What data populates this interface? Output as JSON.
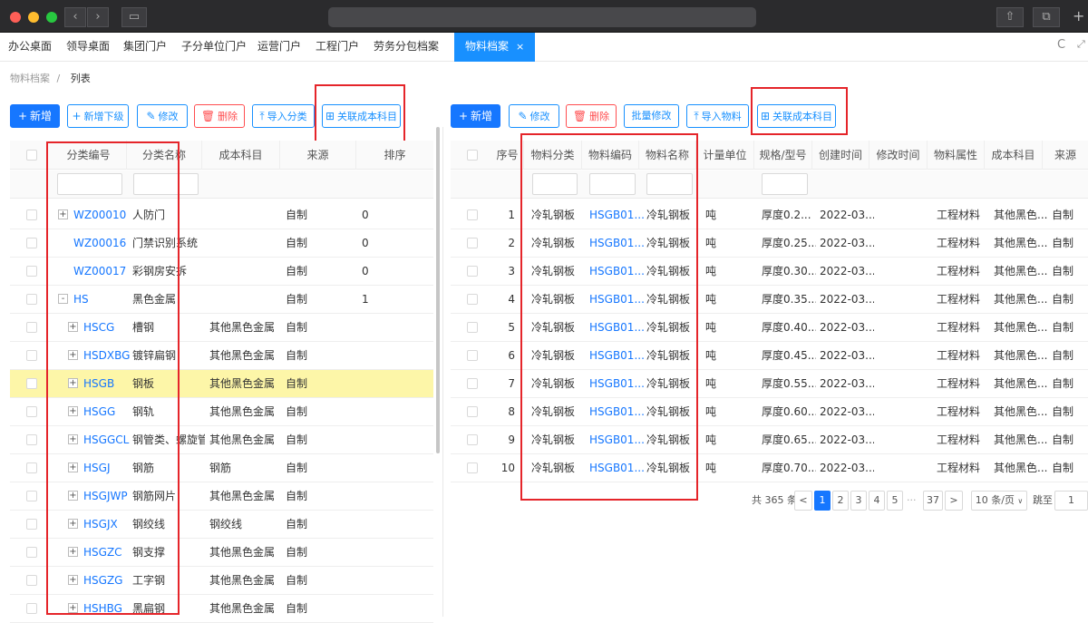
{
  "tabs": [
    {
      "label": "办公桌面"
    },
    {
      "label": "领导桌面"
    },
    {
      "label": "集团门户"
    },
    {
      "label": "子分单位门户"
    },
    {
      "label": "运营门户"
    },
    {
      "label": "工程门户"
    },
    {
      "label": "劳务分包档案"
    },
    {
      "label": "物料档案",
      "close": "×"
    }
  ],
  "breadcrumb": {
    "parent": "物料档案",
    "sep": "/",
    "current": "列表"
  },
  "left_toolbar": {
    "add": "新增",
    "add_sub": "新增下级",
    "edit": "修改",
    "delete": "删除",
    "import": "导入分类",
    "link_cost": "关联成本科目"
  },
  "right_toolbar": {
    "add": "新增",
    "edit": "修改",
    "delete": "删除",
    "batch_edit": "批量修改",
    "import": "导入物料",
    "link_cost": "关联成本科目"
  },
  "left_table": {
    "headers": [
      "分类编号",
      "分类名称",
      "成本科目",
      "来源",
      "排序"
    ],
    "rows": [
      {
        "exp": "+",
        "code": "WZ00010",
        "name": "人防门",
        "cost": "",
        "source": "自制",
        "sort": "0",
        "level": 0
      },
      {
        "exp": "",
        "code": "WZ00016",
        "name": "门禁识别系统",
        "cost": "",
        "source": "自制",
        "sort": "0",
        "level": 0
      },
      {
        "exp": "",
        "code": "WZ00017",
        "name": "彩钢房安拆",
        "cost": "",
        "source": "自制",
        "sort": "0",
        "level": 0
      },
      {
        "exp": "-",
        "code": "HS",
        "name": "黑色金属",
        "cost": "",
        "source": "自制",
        "sort": "1",
        "level": 0
      },
      {
        "exp": "+",
        "code": "HSCG",
        "name": "槽钢",
        "cost": "其他黑色金属",
        "source": "自制",
        "sort": "",
        "level": 1
      },
      {
        "exp": "+",
        "code": "HSDXBG",
        "name": "镀锌扁钢",
        "cost": "其他黑色金属",
        "source": "自制",
        "sort": "",
        "level": 1
      },
      {
        "exp": "+",
        "code": "HSGB",
        "name": "钢板",
        "cost": "其他黑色金属",
        "source": "自制",
        "sort": "",
        "level": 1,
        "highlight": true
      },
      {
        "exp": "+",
        "code": "HSGG",
        "name": "钢轨",
        "cost": "其他黑色金属",
        "source": "自制",
        "sort": "",
        "level": 1
      },
      {
        "exp": "+",
        "code": "HSGGCL",
        "name": "钢管类、螺旋管",
        "cost": "其他黑色金属",
        "source": "自制",
        "sort": "",
        "level": 1
      },
      {
        "exp": "+",
        "code": "HSGJ",
        "name": "钢筋",
        "cost": "钢筋",
        "source": "自制",
        "sort": "",
        "level": 1
      },
      {
        "exp": "+",
        "code": "HSGJWP",
        "name": "钢筋网片",
        "cost": "其他黑色金属",
        "source": "自制",
        "sort": "",
        "level": 1
      },
      {
        "exp": "+",
        "code": "HSGJX",
        "name": "钢绞线",
        "cost": "钢绞线",
        "source": "自制",
        "sort": "",
        "level": 1
      },
      {
        "exp": "+",
        "code": "HSGZC",
        "name": "钢支撑",
        "cost": "其他黑色金属",
        "source": "自制",
        "sort": "",
        "level": 1
      },
      {
        "exp": "+",
        "code": "HSGZG",
        "name": "工字钢",
        "cost": "其他黑色金属",
        "source": "自制",
        "sort": "",
        "level": 1
      },
      {
        "exp": "+",
        "code": "HSHBG",
        "name": "黑扁钢",
        "cost": "其他黑色金属",
        "source": "自制",
        "sort": "",
        "level": 1
      }
    ]
  },
  "right_table": {
    "headers": [
      "序号",
      "物料分类",
      "物料编码",
      "物料名称",
      "计量单位",
      "规格/型号",
      "创建时间",
      "修改时间",
      "物料属性",
      "成本科目",
      "来源"
    ],
    "rows": [
      {
        "no": "1",
        "cat": "冷轧钢板",
        "code": "HSGB01...",
        "name": "冷轧钢板",
        "unit": "吨",
        "spec": "厚度0.2...",
        "created": "2022-03...",
        "modified": "",
        "attr": "工程材料",
        "cost": "其他黑色...",
        "source": "自制"
      },
      {
        "no": "2",
        "cat": "冷轧钢板",
        "code": "HSGB01...",
        "name": "冷轧钢板",
        "unit": "吨",
        "spec": "厚度0.25...",
        "created": "2022-03...",
        "modified": "",
        "attr": "工程材料",
        "cost": "其他黑色...",
        "source": "自制"
      },
      {
        "no": "3",
        "cat": "冷轧钢板",
        "code": "HSGB01...",
        "name": "冷轧钢板",
        "unit": "吨",
        "spec": "厚度0.30...",
        "created": "2022-03...",
        "modified": "",
        "attr": "工程材料",
        "cost": "其他黑色...",
        "source": "自制"
      },
      {
        "no": "4",
        "cat": "冷轧钢板",
        "code": "HSGB01...",
        "name": "冷轧钢板",
        "unit": "吨",
        "spec": "厚度0.35...",
        "created": "2022-03...",
        "modified": "",
        "attr": "工程材料",
        "cost": "其他黑色...",
        "source": "自制"
      },
      {
        "no": "5",
        "cat": "冷轧钢板",
        "code": "HSGB01...",
        "name": "冷轧钢板",
        "unit": "吨",
        "spec": "厚度0.40...",
        "created": "2022-03...",
        "modified": "",
        "attr": "工程材料",
        "cost": "其他黑色...",
        "source": "自制"
      },
      {
        "no": "6",
        "cat": "冷轧钢板",
        "code": "HSGB01...",
        "name": "冷轧钢板",
        "unit": "吨",
        "spec": "厚度0.45...",
        "created": "2022-03...",
        "modified": "",
        "attr": "工程材料",
        "cost": "其他黑色...",
        "source": "自制"
      },
      {
        "no": "7",
        "cat": "冷轧钢板",
        "code": "HSGB01...",
        "name": "冷轧钢板",
        "unit": "吨",
        "spec": "厚度0.55...",
        "created": "2022-03...",
        "modified": "",
        "attr": "工程材料",
        "cost": "其他黑色...",
        "source": "自制"
      },
      {
        "no": "8",
        "cat": "冷轧钢板",
        "code": "HSGB01...",
        "name": "冷轧钢板",
        "unit": "吨",
        "spec": "厚度0.60...",
        "created": "2022-03...",
        "modified": "",
        "attr": "工程材料",
        "cost": "其他黑色...",
        "source": "自制"
      },
      {
        "no": "9",
        "cat": "冷轧钢板",
        "code": "HSGB01...",
        "name": "冷轧钢板",
        "unit": "吨",
        "spec": "厚度0.65...",
        "created": "2022-03...",
        "modified": "",
        "attr": "工程材料",
        "cost": "其他黑色...",
        "source": "自制"
      },
      {
        "no": "10",
        "cat": "冷轧钢板",
        "code": "HSGB01...",
        "name": "冷轧钢板",
        "unit": "吨",
        "spec": "厚度0.70...",
        "created": "2022-03...",
        "modified": "",
        "attr": "工程材料",
        "cost": "其他黑色...",
        "source": "自制"
      }
    ]
  },
  "pagination": {
    "total": "共 365 条",
    "prev": "<",
    "pages": [
      "1",
      "2",
      "3",
      "4",
      "5"
    ],
    "ellipsis": "···",
    "last": "37",
    "next": ">",
    "page_size": "10 条/页",
    "jump_label": "跳至",
    "jump_value": "1",
    "current": "1"
  },
  "colors": {
    "accent": "#1677ff",
    "danger": "#ff4d4f",
    "highlight_row": "#fdf6a8",
    "annotation": "#e5252a"
  }
}
